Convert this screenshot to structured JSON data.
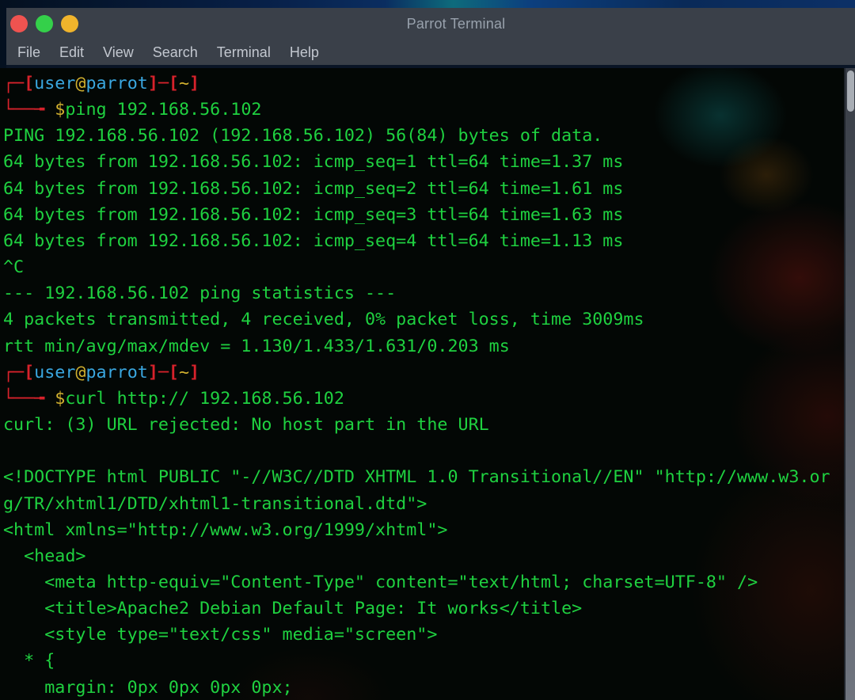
{
  "palette": {
    "header_bg": "#3a4049",
    "menu_text": "#c2c7cf",
    "title_text": "#98a1ac",
    "term_green": "#1fd140",
    "term_red": "#d7222b",
    "term_blue": "#3aa7e0",
    "term_gold": "#d2b12f",
    "light_red": "#ef5350",
    "light_green": "#34d04a",
    "light_amber": "#f0b42c",
    "scroll_thumb": "#a9aeb5"
  },
  "window": {
    "title": "Parrot Terminal",
    "menu": [
      "File",
      "Edit",
      "View",
      "Search",
      "Terminal",
      "Help"
    ]
  },
  "terminal": {
    "lines": [
      [
        {
          "t": "┌─[",
          "c": "red"
        },
        {
          "t": "user",
          "c": "blue"
        },
        {
          "t": "@",
          "c": "gold"
        },
        {
          "t": "parrot",
          "c": "blue"
        },
        {
          "t": "]─[",
          "c": "red"
        },
        {
          "t": "~",
          "c": "gold"
        },
        {
          "t": "]",
          "c": "red"
        }
      ],
      [
        {
          "t": "└──╼ ",
          "c": "red"
        },
        {
          "t": "$",
          "c": "gold"
        },
        {
          "t": "ping 192.168.56.102",
          "c": "green"
        }
      ],
      [
        {
          "t": "PING 192.168.56.102 (192.168.56.102) 56(84) bytes of data.",
          "c": "green"
        }
      ],
      [
        {
          "t": "64 bytes from 192.168.56.102: icmp_seq=1 ttl=64 time=1.37 ms",
          "c": "green"
        }
      ],
      [
        {
          "t": "64 bytes from 192.168.56.102: icmp_seq=2 ttl=64 time=1.61 ms",
          "c": "green"
        }
      ],
      [
        {
          "t": "64 bytes from 192.168.56.102: icmp_seq=3 ttl=64 time=1.63 ms",
          "c": "green"
        }
      ],
      [
        {
          "t": "64 bytes from 192.168.56.102: icmp_seq=4 ttl=64 time=1.13 ms",
          "c": "green"
        }
      ],
      [
        {
          "t": "^C",
          "c": "green"
        }
      ],
      [
        {
          "t": "--- 192.168.56.102 ping statistics ---",
          "c": "green"
        }
      ],
      [
        {
          "t": "4 packets transmitted, 4 received, 0% packet loss, time 3009ms",
          "c": "green"
        }
      ],
      [
        {
          "t": "rtt min/avg/max/mdev = 1.130/1.433/1.631/0.203 ms",
          "c": "green"
        }
      ],
      [
        {
          "t": "┌─[",
          "c": "red"
        },
        {
          "t": "user",
          "c": "blue"
        },
        {
          "t": "@",
          "c": "gold"
        },
        {
          "t": "parrot",
          "c": "blue"
        },
        {
          "t": "]─[",
          "c": "red"
        },
        {
          "t": "~",
          "c": "gold"
        },
        {
          "t": "]",
          "c": "red"
        }
      ],
      [
        {
          "t": "└──╼ ",
          "c": "red"
        },
        {
          "t": "$",
          "c": "gold"
        },
        {
          "t": "curl http:// 192.168.56.102",
          "c": "green"
        }
      ],
      [
        {
          "t": "curl: (3) URL rejected: No host part in the URL",
          "c": "green"
        }
      ],
      [],
      [
        {
          "t": "<!DOCTYPE html PUBLIC \"-//W3C//DTD XHTML 1.0 Transitional//EN\" \"http://www.w3.or",
          "c": "green"
        }
      ],
      [
        {
          "t": "g/TR/xhtml1/DTD/xhtml1-transitional.dtd\">",
          "c": "green"
        }
      ],
      [
        {
          "t": "<html xmlns=\"http://www.w3.org/1999/xhtml\">",
          "c": "green"
        }
      ],
      [
        {
          "t": "  <head>",
          "c": "green"
        }
      ],
      [
        {
          "t": "    <meta http-equiv=\"Content-Type\" content=\"text/html; charset=UTF-8\" />",
          "c": "green"
        }
      ],
      [
        {
          "t": "    <title>Apache2 Debian Default Page: It works</title>",
          "c": "green"
        }
      ],
      [
        {
          "t": "    <style type=\"text/css\" media=\"screen\">",
          "c": "green"
        }
      ],
      [
        {
          "t": "  * {",
          "c": "green"
        }
      ],
      [
        {
          "t": "    margin: 0px 0px 0px 0px;",
          "c": "green"
        }
      ]
    ]
  }
}
